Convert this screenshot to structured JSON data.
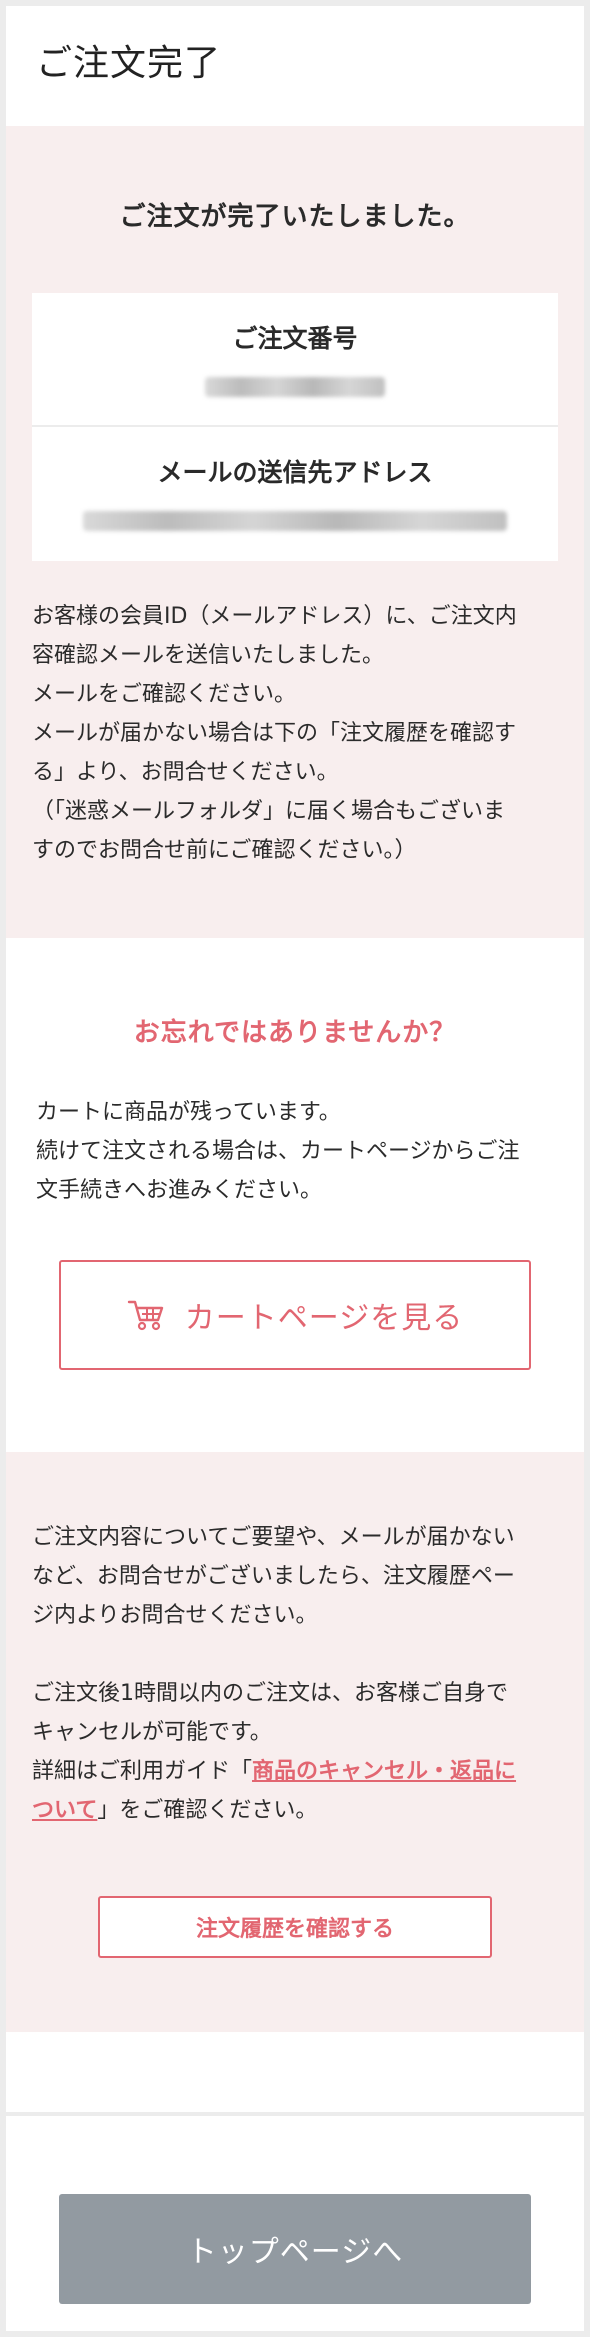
{
  "header": {
    "title": "ご注文完了"
  },
  "complete": {
    "title": "ご注文が完了いたしました。",
    "order_number_label": "ご注文番号",
    "email_label": "メールの送信先アドレス",
    "notice_lines": [
      "お客様の会員ID（メールアドレス）に、ご注文内",
      "容確認メールを送信いたしました。",
      "メールをご確認ください。",
      "メールが届かない場合は下の「注文履歴を確認す",
      "る」より、お問合せください。",
      "（「迷惑メールフォルダ」に届く場合もございま",
      "すのでお問合せ前にご確認ください。）"
    ]
  },
  "reminder": {
    "title": "お忘れではありませんか？",
    "lines": [
      "カートに商品が残っています。",
      "続けて注文される場合は、カートページからご注",
      "文手続きへお進みください。"
    ],
    "cart_button_label": "カートページを見る",
    "cart_icon": "cart-icon"
  },
  "info": {
    "paragraph1_lines": [
      "ご注文内容についてご要望や、メールが届かない",
      "など、お問合せがございましたら、注文履歴ペー",
      "ジ内よりお問合せください。"
    ],
    "paragraph2_line1": "ご注文後1時間以内のご注文は、お客様ご自身で",
    "paragraph2_line2": "キャンセルが可能です。",
    "paragraph2_prefix": "詳細はご利用ガイド「",
    "guide_link_part1": "商品のキャンセル・返品に",
    "guide_link_part2": "ついて",
    "paragraph2_suffix": "」をご確認ください。",
    "history_button_label": "注文履歴を確認する"
  },
  "footer": {
    "top_button_label": "トップページへ"
  },
  "colors": {
    "accent": "#e26671",
    "pink_background": "#f8eeee",
    "top_button": "#929aa1"
  }
}
